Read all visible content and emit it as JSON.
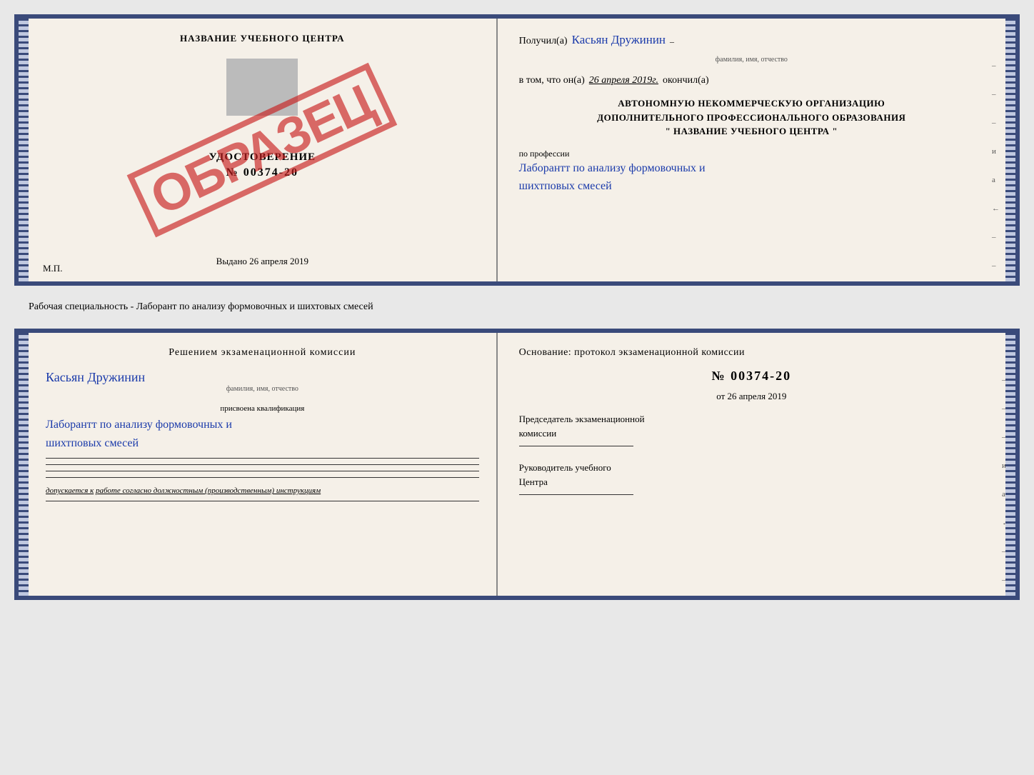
{
  "top_document": {
    "left": {
      "title": "НАЗВАНИЕ УЧЕБНОГО ЦЕНТРА",
      "certificate_label": "УДОСТОВЕРЕНИЕ",
      "cert_number": "№ 00374-20",
      "stamp": "ОБРАЗЕЦ",
      "vydano_label": "Выдано",
      "vydano_date": "26 апреля 2019",
      "mp": "М.П."
    },
    "right": {
      "poluchil_label": "Получил(a)",
      "recipient_name": "Касьян Дружинин",
      "recipient_sub": "фамилия, имя, отчество",
      "vtom_label": "в том, что он(а)",
      "vtom_value": "26 апреля 2019г.",
      "okonchil_label": "окончил(a)",
      "center_text_line1": "АВТОНОМНУЮ НЕКОММЕРЧЕСКУЮ ОРГАНИЗАЦИЮ",
      "center_text_line2": "ДОПОЛНИТЕЛЬНОГО ПРОФЕССИОНАЛЬНОГО ОБРАЗОВАНИЯ",
      "center_text_line3": "\"   НАЗВАНИЕ УЧЕБНОГО ЦЕНТРА   \"",
      "profession_label": "по профессии",
      "profession_value": "Лаборантт по анализу формовочных и шихтповых смесей",
      "dashes": [
        "-",
        "-",
        "-",
        "и",
        "а",
        "←",
        "-",
        "-"
      ]
    }
  },
  "middle": {
    "text": "Рабочая специальность - Лаборант по анализу формовочных и шихтовых смесей"
  },
  "bottom_document": {
    "left": {
      "komissia_title": "Решением экзаменационной комиссии",
      "name": "Касьян Дружинин",
      "name_sub": "фамилия, имя, отчество",
      "kval_label": "присвоена квалификация",
      "kval_value": "Лаборантт по анализу формовочных и шихтповых смесей",
      "dopuskaetsya": "допускается к",
      "dopuskaetsya_val": "работе согласно должностным (производственным) инструкциям"
    },
    "right": {
      "osnov_title": "Основание: протокол экзаменационной комиссии",
      "protocol_number": "№ 00374-20",
      "ot_label": "от",
      "ot_date": "26 апреля 2019",
      "predsedatel_line1": "Председатель экзаменационной",
      "predsedatel_line2": "комиссии",
      "rukovoditel_line1": "Руководитель учебного",
      "rukovoditel_line2": "Центра",
      "dashes": [
        "-",
        "-",
        "-",
        "и",
        "а",
        "←",
        "-",
        "-"
      ]
    }
  }
}
